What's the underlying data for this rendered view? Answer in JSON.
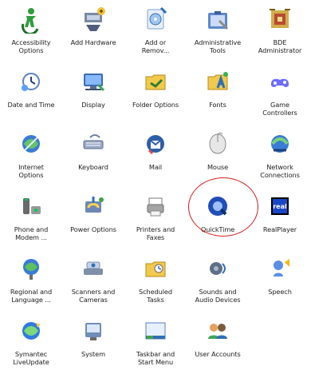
{
  "items": [
    {
      "label": "Accessibility\nOptions",
      "icon": "accessibility-icon"
    },
    {
      "label": "Add Hardware",
      "icon": "add-hardware-icon"
    },
    {
      "label": "Add or\nRemov...",
      "icon": "add-remove-programs-icon"
    },
    {
      "label": "Administrative\nTools",
      "icon": "administrative-tools-icon"
    },
    {
      "label": "BDE\nAdministrator",
      "icon": "bde-administrator-icon"
    },
    {
      "label": "Date and Time",
      "icon": "date-time-icon"
    },
    {
      "label": "Display",
      "icon": "display-icon"
    },
    {
      "label": "Folder Options",
      "icon": "folder-options-icon"
    },
    {
      "label": "Fonts",
      "icon": "fonts-icon"
    },
    {
      "label": "Game\nControllers",
      "icon": "game-controllers-icon"
    },
    {
      "label": "Internet\nOptions",
      "icon": "internet-options-icon"
    },
    {
      "label": "Keyboard",
      "icon": "keyboard-icon"
    },
    {
      "label": "Mail",
      "icon": "mail-icon"
    },
    {
      "label": "Mouse",
      "icon": "mouse-icon"
    },
    {
      "label": "Network\nConnections",
      "icon": "network-connections-icon"
    },
    {
      "label": "Phone and\nModem ...",
      "icon": "phone-modem-icon"
    },
    {
      "label": "Power Options",
      "icon": "power-options-icon"
    },
    {
      "label": "Printers and\nFaxes",
      "icon": "printers-faxes-icon"
    },
    {
      "label": "QuickTime",
      "icon": "quicktime-icon"
    },
    {
      "label": "RealPlayer",
      "icon": "realplayer-icon"
    },
    {
      "label": "Regional and\nLanguage ...",
      "icon": "regional-language-icon"
    },
    {
      "label": "Scanners and\nCameras",
      "icon": "scanners-cameras-icon"
    },
    {
      "label": "Scheduled\nTasks",
      "icon": "scheduled-tasks-icon"
    },
    {
      "label": "Sounds and\nAudio Devices",
      "icon": "sounds-audio-icon"
    },
    {
      "label": "Speech",
      "icon": "speech-icon"
    },
    {
      "label": "Symantec\nLiveUpdate",
      "icon": "symantec-liveupdate-icon"
    },
    {
      "label": "System",
      "icon": "system-icon"
    },
    {
      "label": "Taskbar and\nStart Menu",
      "icon": "taskbar-start-menu-icon"
    },
    {
      "label": "User Accounts",
      "icon": "user-accounts-icon"
    }
  ],
  "highlight": {
    "target": "QuickTime",
    "color": "#d81e1e"
  }
}
